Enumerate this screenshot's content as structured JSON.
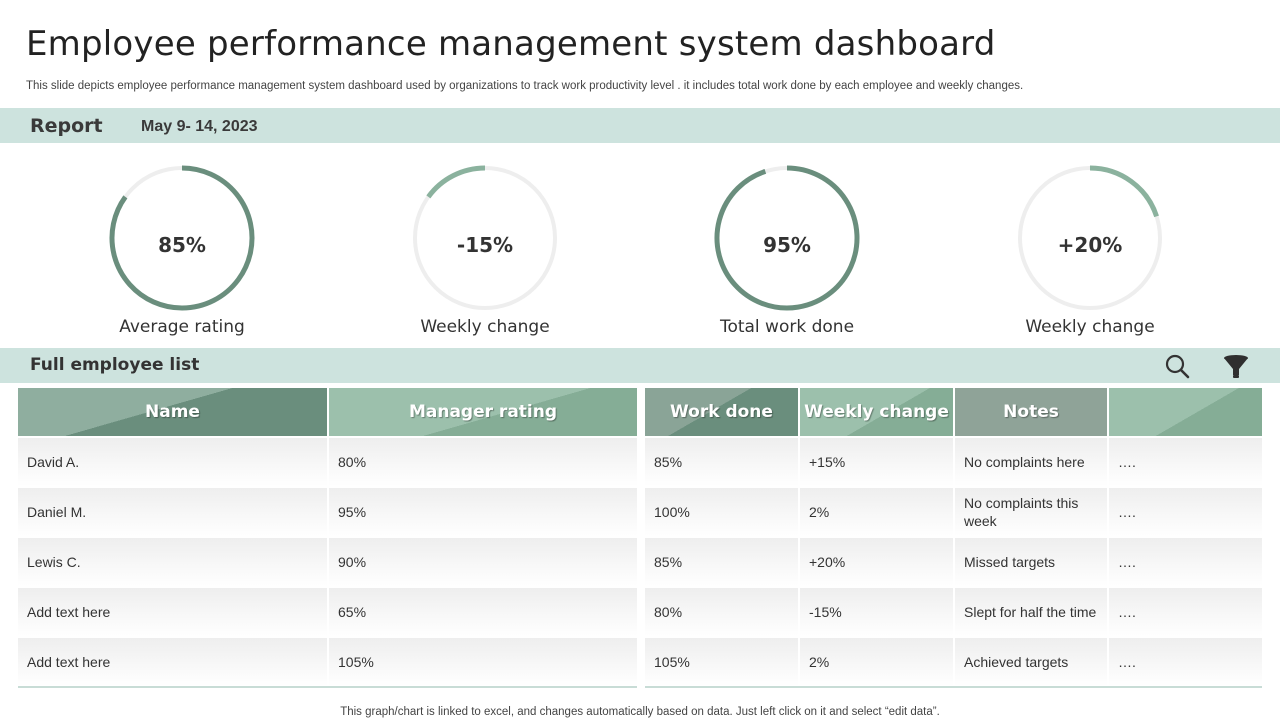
{
  "header": {
    "title": "Employee performance management system dashboard",
    "subtitle": "This slide depicts employee performance management system dashboard used by organizations to track work productivity level . it includes total work done by each employee and weekly changes."
  },
  "report": {
    "label": "Report",
    "date": "May 9- 14, 2023"
  },
  "gauges": [
    {
      "value_text": "85%",
      "label": "Average rating",
      "fraction": 0.85,
      "direction": "clockwise"
    },
    {
      "value_text": "-15%",
      "label": "Weekly change",
      "fraction": 0.15,
      "direction": "counterclockwise"
    },
    {
      "value_text": "95%",
      "label": "Total work done",
      "fraction": 0.95,
      "direction": "clockwise"
    },
    {
      "value_text": "+20%",
      "label": "Weekly change",
      "fraction": 0.2,
      "direction": "clockwise"
    }
  ],
  "employee_list": {
    "label": "Full employee list",
    "search_icon": "search-icon",
    "filter_icon": "filter-icon"
  },
  "table": {
    "columns": [
      "Name",
      "Manager rating",
      "Work done",
      "Weekly change",
      "Notes",
      ""
    ],
    "rows": [
      [
        "David A.",
        "80%",
        "85%",
        "+15%",
        "No complaints here",
        "…."
      ],
      [
        "Daniel M.",
        "95%",
        "100%",
        "2%",
        "No complaints this week",
        "…."
      ],
      [
        "Lewis C.",
        "90%",
        "85%",
        "+20%",
        "Missed targets",
        "…."
      ],
      [
        "Add text here",
        "65%",
        "80%",
        "-15%",
        "Slept for half the time",
        "…."
      ],
      [
        "Add text here",
        "105%",
        "105%",
        "2%",
        "Achieved targets",
        "…."
      ]
    ]
  },
  "footnote": "This graph/chart is linked to excel,  and changes automatically based on data. Just left click on it and select “edit data”.",
  "colors": {
    "accent": "#6a8e7d",
    "accent_light": "#8bb29e",
    "band": "#cde3de",
    "track": "#eeeeee"
  }
}
